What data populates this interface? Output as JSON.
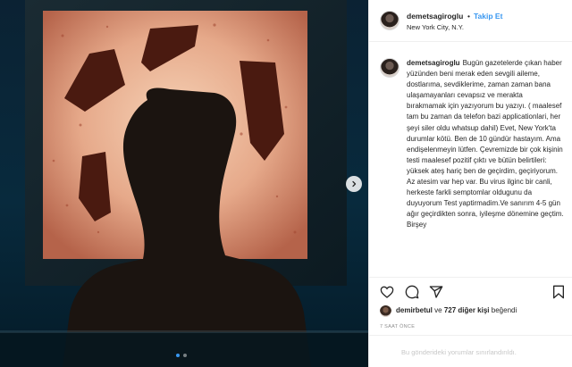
{
  "post": {
    "username": "demetsagiroglu",
    "follow_label": "Takip Et",
    "separator": "•",
    "location": "New York City, N.Y.",
    "caption_username": "demetsagiroglu",
    "caption": "Bugün gazetelerde çıkan haber yüzünden beni merak eden sevgili aileme, dostlarıma, sevdiklerime, zaman zaman bana ulaşamayanları cevapsız ve merakta bırakmamak için yazıyorum bu yazıyı. ( maalesef tam bu zaman da telefon bazi applicationlari, her şeyi siler oldu whatsup dahil) Evet, New York'ta durumlar kötü. Ben de 10 gündür hastayım. Ama endişelenmeyin lütfen. Çevremizde bir çok kişinin testi maalesef pozitif çıktı ve bütün belirtileri: yüksek ateş hariç ben de geçirdim, geçiriyorum. Az atesim var hep var. Bu virus ilginc bir canli, herkeste farkli semptomlar oldugunu da duyuyorum Test yaptirmadim.Ve sanırım 4-5 gün ağır geçirdikten sonra, iyileşme dönemine geçtim. Birşey",
    "likes": {
      "user": "demirbetul",
      "connector": "ve",
      "others": "727 diğer kişi",
      "suffix": "beğendi"
    },
    "timestamp": "7 SAAT ÖNCE",
    "comments_disabled": "Bu gönderideki yorumlar sınırlandırıldı."
  },
  "icons": {
    "like": "heart-icon",
    "comment": "comment-icon",
    "share": "share-icon",
    "save": "bookmark-icon",
    "next": "chevron-right-icon"
  },
  "colors": {
    "link_blue": "#3897f0",
    "text": "#262626",
    "muted": "#8e8e8e"
  }
}
